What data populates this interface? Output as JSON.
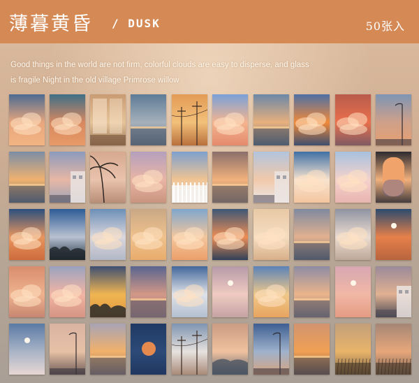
{
  "header": {
    "title_cn": "薄暮黄昏",
    "title_en": "/ DUSK",
    "count": "50张入",
    "bg_color": "#d58a56"
  },
  "tagline": {
    "line1": "Good things in the world are not firm, colorful clouds are easy to disperse, and glass",
    "line2": "is fragile Night in the old village Primrose willow"
  },
  "cards": [
    {
      "name": "card-blue-sky-orange-clouds",
      "top": "#4d6b93",
      "mid": "#e8a67c",
      "bot": "#f3b483",
      "feature": "clouds"
    },
    {
      "name": "card-teal-orange-clouds",
      "top": "#3f6f86",
      "mid": "#d78860",
      "bot": "#e89a68",
      "feature": "clouds"
    },
    {
      "name": "card-window-interior",
      "top": "#c99b72",
      "mid": "#e6c49a",
      "bot": "#9e7a5b",
      "feature": "window"
    },
    {
      "name": "card-blue-sea-sunset",
      "top": "#5e7b97",
      "mid": "#a5b0ba",
      "bot": "#6c7c8a",
      "feature": "sea"
    },
    {
      "name": "card-power-poles",
      "top": "#e39b55",
      "mid": "#f2c07a",
      "bot": "#b9703b",
      "feature": "poles"
    },
    {
      "name": "card-pink-cloud-blue",
      "top": "#7aa1d8",
      "mid": "#f3b48f",
      "bot": "#e58a6e",
      "feature": "clouds"
    },
    {
      "name": "card-dusk-horizon",
      "top": "#6b87a8",
      "mid": "#e8b07c",
      "bot": "#5c6d82",
      "feature": "sea"
    },
    {
      "name": "card-orange-glow-cloud",
      "top": "#4e6fa5",
      "mid": "#f08a3a",
      "bot": "#3e4e6e",
      "feature": "clouds"
    },
    {
      "name": "card-red-orange-cloud",
      "top": "#b85b4c",
      "mid": "#e9704c",
      "bot": "#7f5a64",
      "feature": "clouds"
    },
    {
      "name": "card-streetlamp-dusk",
      "top": "#7e95b4",
      "mid": "#cfa089",
      "bot": "#e7a071",
      "feature": "lamp"
    },
    {
      "name": "card-sunset-sea",
      "top": "#7c8ea6",
      "mid": "#f0b16f",
      "bot": "#5e6a7c",
      "feature": "sea"
    },
    {
      "name": "card-building-sky",
      "top": "#8c9bbd",
      "mid": "#e7b7a5",
      "bot": "#9aa3b6",
      "feature": "building"
    },
    {
      "name": "card-palm-tree",
      "top": "#d6a98f",
      "mid": "#eac3ad",
      "bot": "#b88e78",
      "feature": "palm"
    },
    {
      "name": "card-purple-clouds",
      "top": "#b4a0be",
      "mid": "#e9b4a4",
      "bot": "#c99580",
      "feature": "clouds"
    },
    {
      "name": "card-white-fence",
      "top": "#7ea0cf",
      "mid": "#f0c493",
      "bot": "#e9e4e2",
      "feature": "fence"
    },
    {
      "name": "card-golden-sea",
      "top": "#8a6f6b",
      "mid": "#f1b27d",
      "bot": "#a2806c",
      "feature": "sea"
    },
    {
      "name": "card-house-sky",
      "top": "#b2c4de",
      "mid": "#f1c9a9",
      "bot": "#eae7ea",
      "feature": "house"
    },
    {
      "name": "card-white-cumulus",
      "top": "#3f70a5",
      "mid": "#f8e3d0",
      "bot": "#f3c59e",
      "feature": "clouds"
    },
    {
      "name": "card-pink-cumulus",
      "top": "#a8c1de",
      "mid": "#f5d2cc",
      "bot": "#e8b5b0",
      "feature": "clouds"
    },
    {
      "name": "card-airplane-window",
      "top": "#2c2a30",
      "mid": "#f1b07c",
      "bot": "#433c3e",
      "feature": "plane"
    },
    {
      "name": "card-deep-blue-orange",
      "top": "#2b4f7e",
      "mid": "#e8955f",
      "bot": "#cd6c3c",
      "feature": "clouds"
    },
    {
      "name": "card-blue-treeline",
      "top": "#2d5c96",
      "mid": "#b9c1d0",
      "bot": "#223544",
      "feature": "trees"
    },
    {
      "name": "card-pale-blue-cloud",
      "top": "#6c8fb8",
      "mid": "#dad6dc",
      "bot": "#b2b8c7",
      "feature": "clouds"
    },
    {
      "name": "card-peach-sky",
      "top": "#c9a886",
      "mid": "#efc18c",
      "bot": "#e8ac6d",
      "feature": "clouds"
    },
    {
      "name": "card-sky-orange-puffs",
      "top": "#7fa6ce",
      "mid": "#f3c69d",
      "bot": "#ec9f6a",
      "feature": "clouds"
    },
    {
      "name": "card-navy-orange-stripe",
      "top": "#3d5776",
      "mid": "#ed8d55",
      "bot": "#2f4158",
      "feature": "clouds"
    },
    {
      "name": "card-cream-clouds",
      "top": "#e8c9a5",
      "mid": "#f5ddc1",
      "bot": "#d8b08a",
      "feature": "clouds"
    },
    {
      "name": "card-dusky-sea",
      "top": "#7f8aa0",
      "mid": "#e2b08f",
      "bot": "#60697a",
      "feature": "sea"
    },
    {
      "name": "card-grey-white-clouds",
      "top": "#8f93a1",
      "mid": "#ebdcd1",
      "bot": "#bda898",
      "feature": "clouds"
    },
    {
      "name": "card-moon-orange-clouds",
      "top": "#2b4b6e",
      "mid": "#e6804a",
      "bot": "#b8643e",
      "feature": "moon"
    },
    {
      "name": "card-salmon-haze",
      "top": "#d78d6e",
      "mid": "#efb28e",
      "bot": "#c68671",
      "feature": "clouds"
    },
    {
      "name": "card-tall-pink-cloud",
      "top": "#9aa2c0",
      "mid": "#f2b4a3",
      "bot": "#d59484",
      "feature": "clouds"
    },
    {
      "name": "card-yellow-clouds-tree",
      "top": "#3e4f72",
      "mid": "#f0b552",
      "bot": "#e0963c",
      "feature": "trees"
    },
    {
      "name": "card-indigo-dusk",
      "top": "#596590",
      "mid": "#d29786",
      "bot": "#a67f83",
      "feature": "sea"
    },
    {
      "name": "card-blue-white-cloud",
      "top": "#43679b",
      "mid": "#dfe2e8",
      "bot": "#b3bfd0",
      "feature": "clouds"
    },
    {
      "name": "card-pink-moon",
      "top": "#b59aa7",
      "mid": "#f0cac2",
      "bot": "#c4a3a4",
      "feature": "moon"
    },
    {
      "name": "card-blue-yellow-cloud",
      "top": "#5a82b8",
      "mid": "#efc88a",
      "bot": "#e7a45f",
      "feature": "clouds"
    },
    {
      "name": "card-sunset-streaks",
      "top": "#8d8ca4",
      "mid": "#ebb48b",
      "bot": "#8a7a82",
      "feature": "sea"
    },
    {
      "name": "card-pink-crescent",
      "top": "#d7a7b2",
      "mid": "#f1b8a6",
      "bot": "#e49b83",
      "feature": "moon"
    },
    {
      "name": "card-city-dusk",
      "top": "#9a8a9a",
      "mid": "#e1b192",
      "bot": "#4b4a54",
      "feature": "building"
    },
    {
      "name": "card-full-moon-clouds",
      "top": "#5b7aa5",
      "mid": "#a9b4c7",
      "bot": "#e8d7d3",
      "feature": "moon"
    },
    {
      "name": "card-street-sunset",
      "top": "#d9b3a2",
      "mid": "#e7c1a5",
      "bot": "#6d5b58",
      "feature": "lamp"
    },
    {
      "name": "card-golden-horizon",
      "top": "#a7a4b6",
      "mid": "#f2b16a",
      "bot": "#876f6a",
      "feature": "sea"
    },
    {
      "name": "card-orange-moon-blue",
      "top": "#203a64",
      "mid": "#2c4a78",
      "bot": "#203760",
      "feature": "bigmoon"
    },
    {
      "name": "card-crane-cloud",
      "top": "#7e94b0",
      "mid": "#e6e1de",
      "bot": "#a98a78",
      "feature": "poles"
    },
    {
      "name": "card-hills-sunset",
      "top": "#cc9b83",
      "mid": "#f0c29f",
      "bot": "#5e6470",
      "feature": "hills"
    },
    {
      "name": "card-streetlight-blue",
      "top": "#3e5f92",
      "mid": "#9fb2cc",
      "bot": "#d8a37d",
      "feature": "lamp"
    },
    {
      "name": "card-orange-sea",
      "top": "#d29470",
      "mid": "#f0a053",
      "bot": "#6c5143",
      "feature": "sea"
    },
    {
      "name": "card-golden-field",
      "top": "#c29f7b",
      "mid": "#e9b46a",
      "bot": "#7b6447",
      "feature": "field"
    },
    {
      "name": "card-reeds-sunset",
      "top": "#a58676",
      "mid": "#e7a77a",
      "bot": "#7c6455",
      "feature": "field"
    }
  ]
}
